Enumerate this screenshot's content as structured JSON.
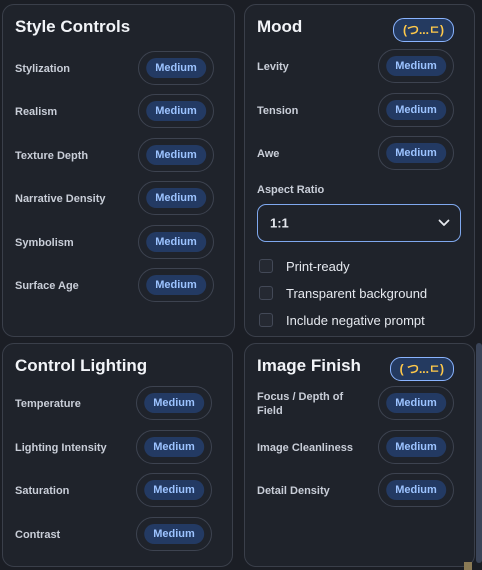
{
  "style_controls": {
    "title": "Style Controls",
    "rows": [
      {
        "label": "Stylization",
        "value": "Medium"
      },
      {
        "label": "Realism",
        "value": "Medium"
      },
      {
        "label": "Texture Depth",
        "value": "Medium"
      },
      {
        "label": "Narrative Density",
        "value": "Medium"
      },
      {
        "label": "Symbolism",
        "value": "Medium"
      },
      {
        "label": "Surface Age",
        "value": "Medium"
      }
    ]
  },
  "mood": {
    "title": "Mood",
    "badge": "(つ...ㄷ)",
    "rows": [
      {
        "label": "Levity",
        "value": "Medium"
      },
      {
        "label": "Tension",
        "value": "Medium"
      },
      {
        "label": "Awe",
        "value": "Medium"
      }
    ],
    "aspect_ratio": {
      "label": "Aspect Ratio",
      "value": "1:1"
    },
    "options": [
      {
        "label": "Print-ready",
        "checked": false
      },
      {
        "label": "Transparent background",
        "checked": false
      },
      {
        "label": "Include negative prompt",
        "checked": false
      }
    ]
  },
  "control_lighting": {
    "title": "Control Lighting",
    "rows": [
      {
        "label": "Temperature",
        "value": "Medium"
      },
      {
        "label": "Lighting Intensity",
        "value": "Medium"
      },
      {
        "label": "Saturation",
        "value": "Medium"
      },
      {
        "label": "Contrast",
        "value": "Medium"
      }
    ]
  },
  "image_finish": {
    "title": "Image Finish",
    "badge": "( つ...ㄷ)",
    "rows": [
      {
        "label": "Focus / Depth of Field",
        "value": "Medium"
      },
      {
        "label": "Image Cleanliness",
        "value": "Medium"
      },
      {
        "label": "Detail Density",
        "value": "Medium"
      }
    ]
  },
  "colors": {
    "background": "#1b1e25",
    "panel": "#1f232b",
    "pill": "#233a63",
    "pill_text": "#9cc3ff",
    "badge_text": "#ffc94a",
    "select_border": "#7fa8ee"
  }
}
